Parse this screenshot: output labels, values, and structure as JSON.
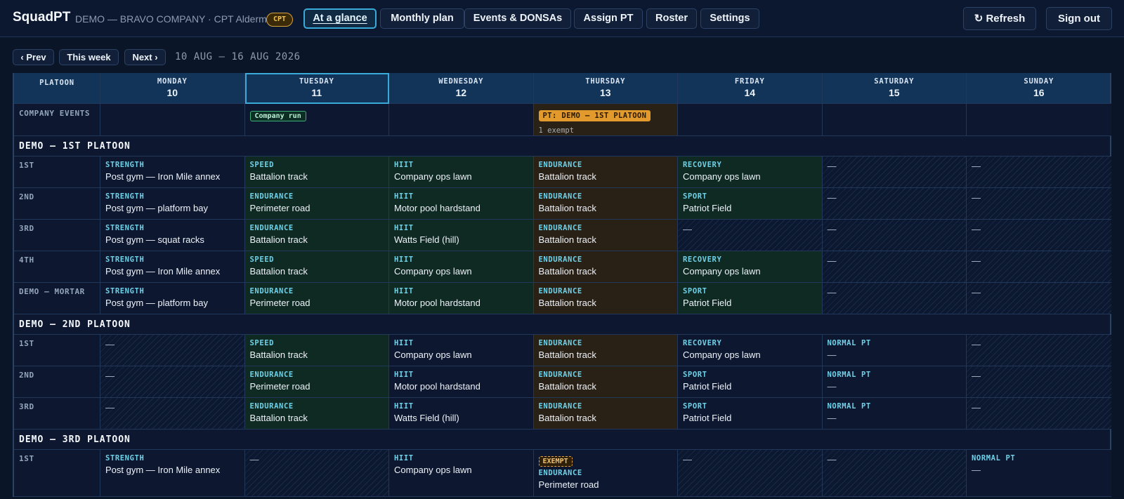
{
  "app": {
    "brand": "SquadPT",
    "company": "DEMO — BRAVO COMPANY · CPT Alderman",
    "rank_badge": "CPT"
  },
  "nav": {
    "tabs": [
      "At a glance",
      "Monthly plan",
      "Events & DONSAs",
      "Assign PT",
      "Roster",
      "Settings"
    ],
    "active": "At a glance",
    "refresh": "↻ Refresh",
    "sign_out": "Sign out"
  },
  "week": {
    "prev": "‹ Prev",
    "this_week": "This week",
    "next": "Next ›",
    "range": "10 AUG — 16 AUG 2026"
  },
  "grid": {
    "platoon_header": "PLATOON",
    "days": [
      {
        "name": "MONDAY",
        "num": "10"
      },
      {
        "name": "TUESDAY",
        "num": "11",
        "today": true
      },
      {
        "name": "WEDNESDAY",
        "num": "12"
      },
      {
        "name": "THURSDAY",
        "num": "13"
      },
      {
        "name": "FRIDAY",
        "num": "14"
      },
      {
        "name": "SATURDAY",
        "num": "15"
      },
      {
        "name": "SUNDAY",
        "num": "16"
      }
    ],
    "company_events": {
      "label": "COMPANY EVENTS",
      "tuesday_event": "Company run",
      "thursday_event": "PT: DEMO — 1ST PLATOON",
      "thursday_note": "1 exempt"
    },
    "platoons": [
      {
        "name": "DEMO — 1ST PLATOON",
        "squads": [
          {
            "name": "1ST",
            "days": [
              {
                "cat": "STRENGTH",
                "loc": "Post gym — Iron Mile annex",
                "tone": "plain"
              },
              {
                "cat": "SPEED",
                "loc": "Battalion track",
                "tone": "green"
              },
              {
                "cat": "HIIT",
                "loc": "Company ops lawn",
                "tone": "green"
              },
              {
                "cat": "ENDURANCE",
                "loc": "Battalion track",
                "tone": "amber"
              },
              {
                "cat": "RECOVERY",
                "loc": "Company ops lawn",
                "tone": "green"
              },
              {
                "empty": "—",
                "tone": "hatch"
              },
              {
                "empty": "—",
                "tone": "hatch"
              }
            ]
          },
          {
            "name": "2ND",
            "days": [
              {
                "cat": "STRENGTH",
                "loc": "Post gym — platform bay",
                "tone": "plain"
              },
              {
                "cat": "ENDURANCE",
                "loc": "Perimeter road",
                "tone": "green"
              },
              {
                "cat": "HIIT",
                "loc": "Motor pool hardstand",
                "tone": "green"
              },
              {
                "cat": "ENDURANCE",
                "loc": "Battalion track",
                "tone": "amber"
              },
              {
                "cat": "SPORT",
                "loc": "Patriot Field",
                "tone": "green"
              },
              {
                "empty": "—",
                "tone": "hatch"
              },
              {
                "empty": "—",
                "tone": "hatch"
              }
            ]
          },
          {
            "name": "3RD",
            "days": [
              {
                "cat": "STRENGTH",
                "loc": "Post gym — squat racks",
                "tone": "plain"
              },
              {
                "cat": "ENDURANCE",
                "loc": "Battalion track",
                "tone": "green"
              },
              {
                "cat": "HIIT",
                "loc": "Watts Field (hill)",
                "tone": "green"
              },
              {
                "cat": "ENDURANCE",
                "loc": "Battalion track",
                "tone": "amber"
              },
              {
                "empty": "—",
                "tone": "hatch"
              },
              {
                "empty": "—",
                "tone": "hatch"
              },
              {
                "empty": "—",
                "tone": "hatch"
              }
            ]
          },
          {
            "name": "4TH",
            "days": [
              {
                "cat": "STRENGTH",
                "loc": "Post gym — Iron Mile annex",
                "tone": "plain"
              },
              {
                "cat": "SPEED",
                "loc": "Battalion track",
                "tone": "green"
              },
              {
                "cat": "HIIT",
                "loc": "Company ops lawn",
                "tone": "green"
              },
              {
                "cat": "ENDURANCE",
                "loc": "Battalion track",
                "tone": "amber"
              },
              {
                "cat": "RECOVERY",
                "loc": "Company ops lawn",
                "tone": "green"
              },
              {
                "empty": "—",
                "tone": "hatch"
              },
              {
                "empty": "—",
                "tone": "hatch"
              }
            ]
          },
          {
            "name": "DEMO — MORTAR",
            "days": [
              {
                "cat": "STRENGTH",
                "loc": "Post gym — platform bay",
                "tone": "plain"
              },
              {
                "cat": "ENDURANCE",
                "loc": "Perimeter road",
                "tone": "green"
              },
              {
                "cat": "HIIT",
                "loc": "Motor pool hardstand",
                "tone": "green"
              },
              {
                "cat": "ENDURANCE",
                "loc": "Battalion track",
                "tone": "amber"
              },
              {
                "cat": "SPORT",
                "loc": "Patriot Field",
                "tone": "green"
              },
              {
                "empty": "—",
                "tone": "hatch"
              },
              {
                "empty": "—",
                "tone": "hatch"
              }
            ]
          }
        ]
      },
      {
        "name": "DEMO — 2ND PLATOON",
        "squads": [
          {
            "name": "1ST",
            "days": [
              {
                "empty": "—",
                "tone": "hatch"
              },
              {
                "cat": "SPEED",
                "loc": "Battalion track",
                "tone": "green"
              },
              {
                "cat": "HIIT",
                "loc": "Company ops lawn",
                "tone": "plain"
              },
              {
                "cat": "ENDURANCE",
                "loc": "Battalion track",
                "tone": "amber"
              },
              {
                "cat": "RECOVERY",
                "loc": "Company ops lawn",
                "tone": "plain"
              },
              {
                "cat": "NORMAL PT",
                "loc": "—",
                "tone": "plain"
              },
              {
                "empty": "—",
                "tone": "hatch"
              }
            ]
          },
          {
            "name": "2ND",
            "days": [
              {
                "empty": "—",
                "tone": "hatch"
              },
              {
                "cat": "ENDURANCE",
                "loc": "Perimeter road",
                "tone": "green"
              },
              {
                "cat": "HIIT",
                "loc": "Motor pool hardstand",
                "tone": "plain"
              },
              {
                "cat": "ENDURANCE",
                "loc": "Battalion track",
                "tone": "amber"
              },
              {
                "cat": "SPORT",
                "loc": "Patriot Field",
                "tone": "plain"
              },
              {
                "cat": "NORMAL PT",
                "loc": "—",
                "tone": "plain"
              },
              {
                "empty": "—",
                "tone": "hatch"
              }
            ]
          },
          {
            "name": "3RD",
            "days": [
              {
                "empty": "—",
                "tone": "hatch"
              },
              {
                "cat": "ENDURANCE",
                "loc": "Battalion track",
                "tone": "green"
              },
              {
                "cat": "HIIT",
                "loc": "Watts Field (hill)",
                "tone": "plain"
              },
              {
                "cat": "ENDURANCE",
                "loc": "Battalion track",
                "tone": "amber"
              },
              {
                "cat": "SPORT",
                "loc": "Patriot Field",
                "tone": "plain"
              },
              {
                "cat": "NORMAL PT",
                "loc": "—",
                "tone": "plain"
              },
              {
                "empty": "—",
                "tone": "hatch"
              }
            ]
          }
        ]
      },
      {
        "name": "DEMO — 3RD PLATOON",
        "squads": [
          {
            "name": "1ST",
            "tall": true,
            "days": [
              {
                "cat": "STRENGTH",
                "loc": "Post gym — Iron Mile annex",
                "tone": "plain"
              },
              {
                "empty": "—",
                "tone": "hatch"
              },
              {
                "cat": "HIIT",
                "loc": "Company ops lawn",
                "tone": "plain"
              },
              {
                "exempt": "EXEMPT",
                "cat": "ENDURANCE",
                "loc": "Perimeter road",
                "tone": "plain"
              },
              {
                "empty": "—",
                "tone": "hatch"
              },
              {
                "empty": "—",
                "tone": "hatch"
              },
              {
                "cat": "NORMAL PT",
                "loc": "—",
                "tone": "plain"
              }
            ]
          }
        ]
      }
    ]
  },
  "colors": {
    "background": "#0b1528",
    "accent": "#3aaad8",
    "category": "#6fd1e8",
    "event_green": "#3eb07a",
    "event_orange": "#e39a2c"
  }
}
